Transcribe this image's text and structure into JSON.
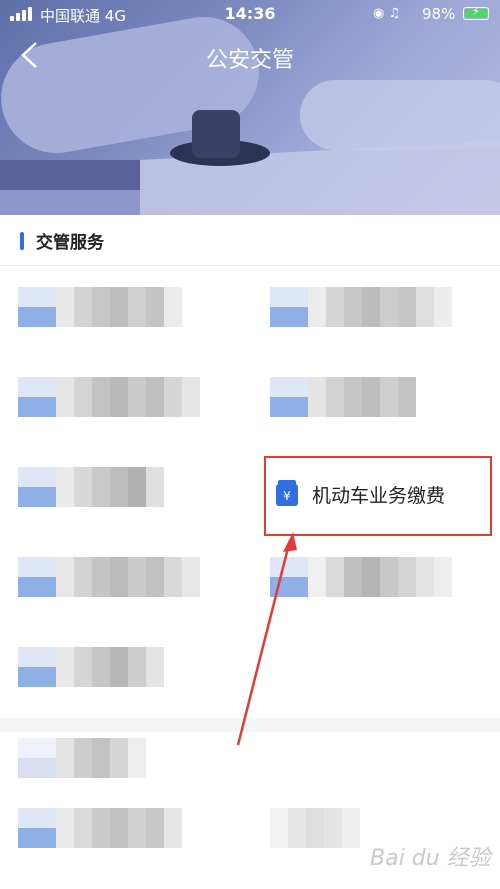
{
  "status_bar": {
    "carrier": "中国联通",
    "network": "4G",
    "time": "14:36",
    "battery": "98%"
  },
  "nav": {
    "title": "公安交管"
  },
  "section": {
    "title": "交管服务"
  },
  "highlighted_item": {
    "label": "机动车业务缴费",
    "icon": "wallet-yen-icon"
  },
  "watermark": "Bai du 经验",
  "colors": {
    "accent": "#2f6fe0",
    "highlight_border": "#e33a36",
    "annotation_arrow": "#e33a36",
    "battery": "#4cd964"
  }
}
